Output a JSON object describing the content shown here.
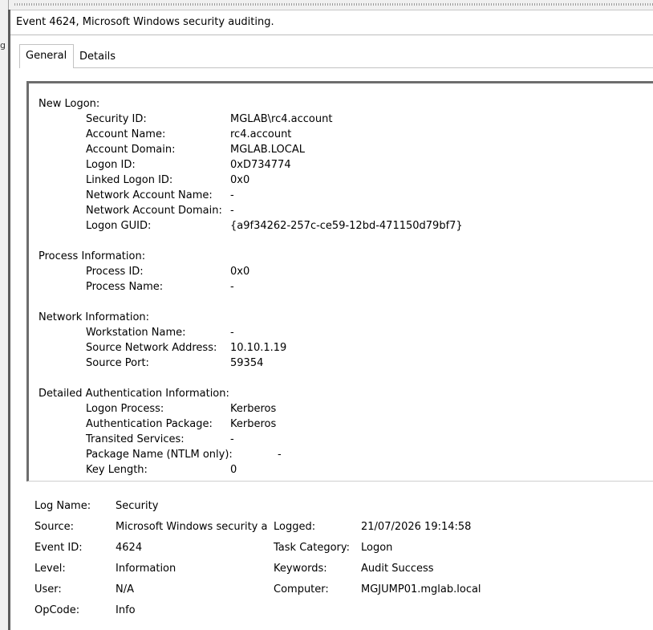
{
  "window": {
    "left_glyph": "g"
  },
  "header": {
    "title": "Event 4624, Microsoft Windows security auditing."
  },
  "tabs": [
    {
      "label": "General"
    },
    {
      "label": "Details"
    }
  ],
  "description": {
    "new_logon": {
      "title": "New Logon:",
      "rows": [
        {
          "key": "Security ID:",
          "value": "MGLAB\\rc4.account"
        },
        {
          "key": "Account Name:",
          "value": "rc4.account"
        },
        {
          "key": "Account Domain:",
          "value": "MGLAB.LOCAL"
        },
        {
          "key": "Logon ID:",
          "value": "0xD734774"
        },
        {
          "key": "Linked Logon ID:",
          "value": "0x0"
        },
        {
          "key": "Network Account Name:",
          "value": "-"
        },
        {
          "key": "Network Account Domain:",
          "value": "-"
        },
        {
          "key": "Logon GUID:",
          "value": "{a9f34262-257c-ce59-12bd-471150d79bf7}"
        }
      ]
    },
    "process_information": {
      "title": "Process Information:",
      "rows": [
        {
          "key": "Process ID:",
          "value": "0x0"
        },
        {
          "key": "Process Name:",
          "value": "-"
        }
      ]
    },
    "network_information": {
      "title": "Network Information:",
      "rows": [
        {
          "key": "Workstation Name:",
          "value": "-"
        },
        {
          "key": "Source Network Address:",
          "value": "10.10.1.19"
        },
        {
          "key": "Source Port:",
          "value": "59354"
        }
      ]
    },
    "auth_information": {
      "title": "Detailed Authentication Information:",
      "rows": [
        {
          "key": "Logon Process:",
          "value": "Kerberos"
        },
        {
          "key": "Authentication Package:",
          "value": "Kerberos"
        },
        {
          "key": "Transited Services:",
          "value": "-"
        },
        {
          "key": "Package Name (NTLM only):",
          "value": "-"
        },
        {
          "key": "Key Length:",
          "value": "0"
        }
      ]
    }
  },
  "properties": {
    "log_name": {
      "label": "Log Name:",
      "value": "Security"
    },
    "source": {
      "label": "Source:",
      "value": "Microsoft Windows security auditing."
    },
    "logged": {
      "label": "Logged:",
      "value": "21/07/2026 19:14:58"
    },
    "event_id": {
      "label": "Event ID:",
      "value": "4624"
    },
    "task_category": {
      "label": "Task Category:",
      "value": "Logon"
    },
    "level": {
      "label": "Level:",
      "value": "Information"
    },
    "keywords": {
      "label": "Keywords:",
      "value": "Audit Success"
    },
    "user": {
      "label": "User:",
      "value": "N/A"
    },
    "computer": {
      "label": "Computer:",
      "value": "MGJUMP01.mglab.local"
    },
    "opcode": {
      "label": "OpCode:",
      "value": "Info"
    }
  }
}
